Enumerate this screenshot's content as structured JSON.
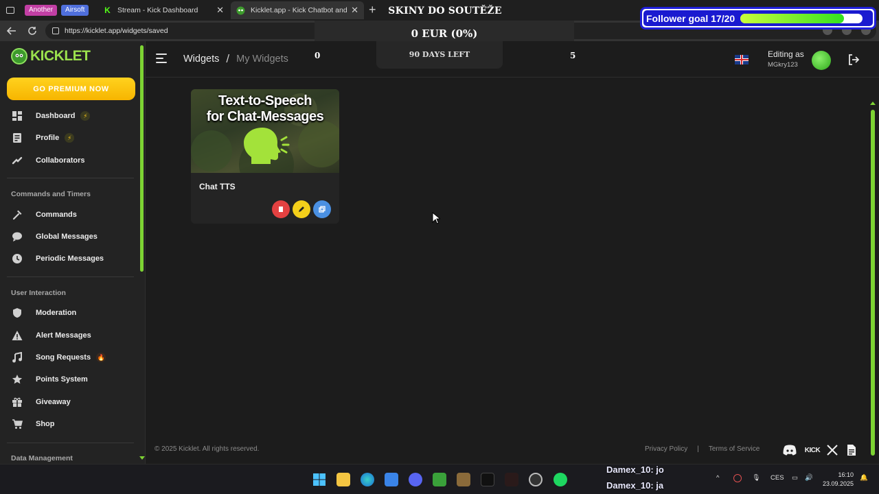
{
  "browser": {
    "group_pills": [
      "Another",
      "Airsoft"
    ],
    "tabs": [
      {
        "title": "Stream - Kick Dashboard"
      },
      {
        "title": "Kicklet.app - Kick Chatbot and O"
      }
    ],
    "url": "https://kicklet.app/widgets/saved"
  },
  "overlay": {
    "title": "SKINY DO SOUTĚŽE",
    "amount": "0 EUR (0%)",
    "follower_goal_label": "Follower goal 17/20",
    "follower_goal_progress": 0.85,
    "stat_left": "0",
    "days_left": "90 DAYS LEFT",
    "stat_right": "5"
  },
  "sidebar": {
    "brand": "KICKLET",
    "premium_label": "GO PREMIUM NOW",
    "items_top": [
      {
        "label": "Dashboard",
        "icon": "dashboard-icon",
        "badge": "bolt"
      },
      {
        "label": "Profile",
        "icon": "profile-icon",
        "badge": "bolt"
      },
      {
        "label": "Collaborators",
        "icon": "collaborators-icon"
      }
    ],
    "section_commands": "Commands and Timers",
    "items_commands": [
      {
        "label": "Commands",
        "icon": "hammer-icon"
      },
      {
        "label": "Global Messages",
        "icon": "chat-bubble-icon"
      },
      {
        "label": "Periodic Messages",
        "icon": "clock-icon"
      }
    ],
    "section_interaction": "User Interaction",
    "items_interaction": [
      {
        "label": "Moderation",
        "icon": "shield-icon"
      },
      {
        "label": "Alert Messages",
        "icon": "alert-icon"
      },
      {
        "label": "Song Requests",
        "icon": "music-note-icon",
        "badge": "fire"
      },
      {
        "label": "Points System",
        "icon": "star-icon"
      },
      {
        "label": "Giveaway",
        "icon": "gift-icon"
      },
      {
        "label": "Shop",
        "icon": "cart-icon"
      }
    ],
    "section_data": "Data Management"
  },
  "header": {
    "breadcrumb_root": "Widgets",
    "breadcrumb_sep": "/",
    "breadcrumb_current": "My Widgets",
    "editing_label": "Editing as",
    "username": "MGkry123"
  },
  "widget_card": {
    "thumb_line1": "Text-to-Speech",
    "thumb_line2": "for Chat-Messages",
    "title": "Chat TTS"
  },
  "footer": {
    "copyright": "© 2025 Kicklet. All rights reserved.",
    "privacy": "Privacy Policy",
    "sep": "|",
    "terms": "Terms of Service",
    "kick_label": "KICK"
  },
  "taskbar": {
    "chat_lines": [
      "Damex_10: jo",
      "Damex_10: ja"
    ],
    "lang": "CES",
    "time": "16:10",
    "date": "23.09.2025"
  },
  "colors": {
    "accent_green": "#7dd333",
    "premium_yellow": "#f7b500",
    "delete_red": "#e34141",
    "edit_yellow": "#f3cf1a",
    "copy_blue": "#4a90e2"
  }
}
